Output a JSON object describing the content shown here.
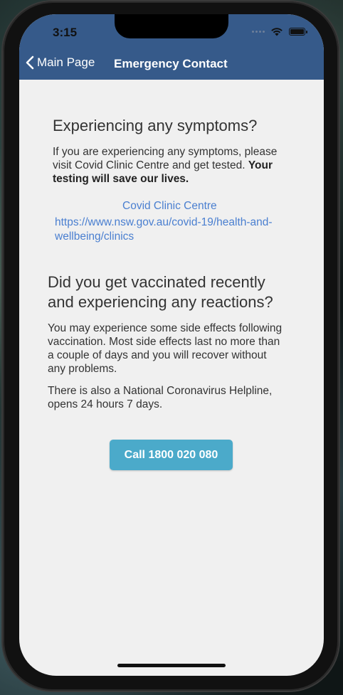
{
  "status_bar": {
    "time": "3:15"
  },
  "nav": {
    "back_label": "Main Page",
    "title": "Emergency Contact"
  },
  "symptoms": {
    "heading": "Experiencing any symptoms?",
    "text_plain": "If you are experiencing any symptoms, please visit Covid Clinic Centre and get tested. ",
    "text_bold": "Your testing will save our lives.",
    "link_title": "Covid Clinic Centre",
    "link_url_line1": "https://www.nsw.gov.au/covid-19/health-and-",
    "link_url_line2": "wellbeing/clinics"
  },
  "vaccination": {
    "heading_line1": "Did you get vaccinated recently",
    "heading_line2": "and experiencing any reactions?",
    "para1_line1": "You may experience some side effects following",
    "para1_line2": "vaccination. Most side effects last no more than",
    "para1_line3": "a couple of days and you will recover without",
    "para1_line4": "any problems.",
    "para2_line1": "There is also a National Coronavirus Helpline,",
    "para2_line2": "opens 24 hours 7 days."
  },
  "call_button": {
    "label": "Call 1800 020 080",
    "color": "#4baaca"
  },
  "colors": {
    "header": "#365a8a",
    "link": "#4a7fd0",
    "background": "#f0f0f0"
  }
}
